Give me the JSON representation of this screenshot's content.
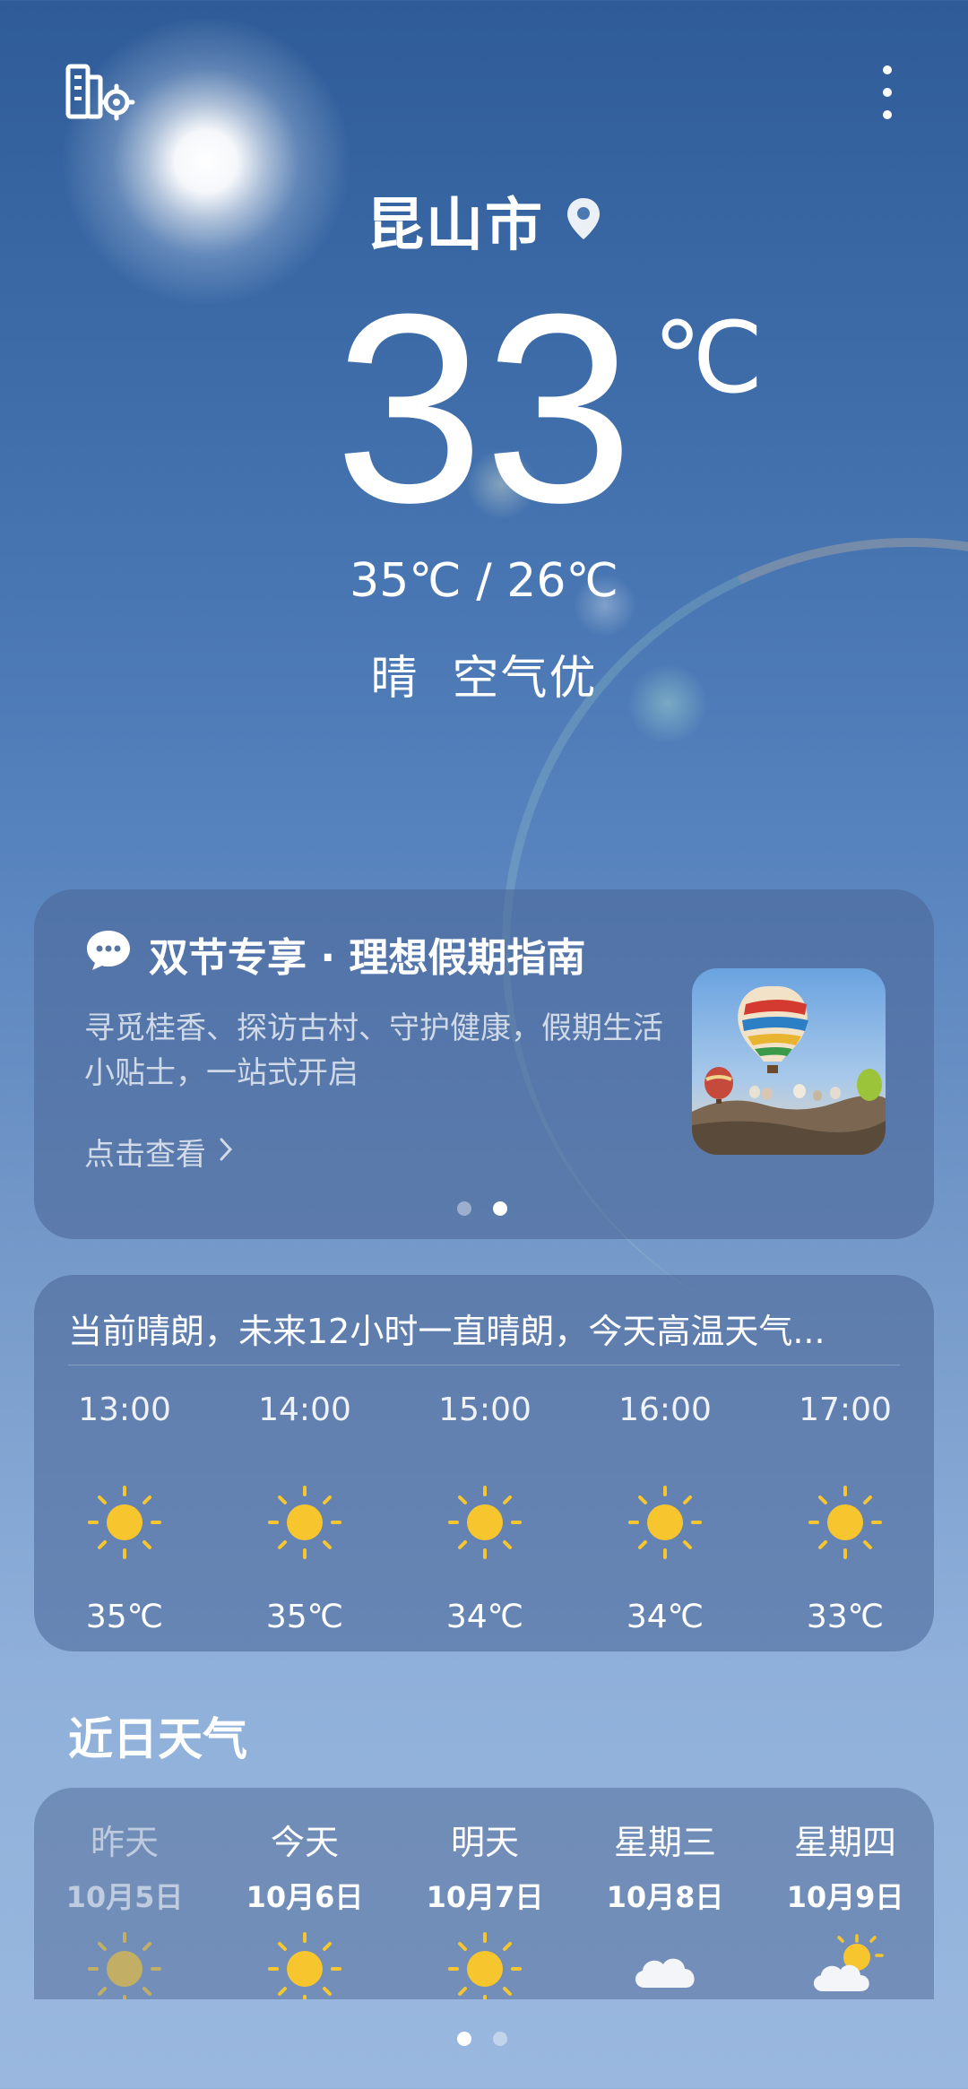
{
  "location": {
    "city": "昆山市"
  },
  "current": {
    "temperature": "33",
    "unit": "℃",
    "range": "35℃ / 26℃",
    "condition": "晴  空气优"
  },
  "promo": {
    "title": "双节专享 · 理想假期指南",
    "description": "寻觅桂香、探访古村、守护健康，假期生活小贴士，一站式开启",
    "link": "点击查看",
    "image": "hot-air-balloons",
    "page_count": 2,
    "active_page": 2
  },
  "hourly": {
    "summary": "当前晴朗，未来12小时一直晴朗，今天高温天气...",
    "items": [
      {
        "time": "13:00",
        "icon": "sunny-icon",
        "temp": "35℃"
      },
      {
        "time": "14:00",
        "icon": "sunny-icon",
        "temp": "35℃"
      },
      {
        "time": "15:00",
        "icon": "sunny-icon",
        "temp": "34℃"
      },
      {
        "time": "16:00",
        "icon": "sunny-icon",
        "temp": "34℃"
      },
      {
        "time": "17:00",
        "icon": "sunny-icon",
        "temp": "33℃"
      }
    ]
  },
  "daily": {
    "title": "近日天气",
    "items": [
      {
        "day": "昨天",
        "date": "10月5日",
        "icon": "sunny-icon"
      },
      {
        "day": "今天",
        "date": "10月6日",
        "icon": "sunny-icon"
      },
      {
        "day": "明天",
        "date": "10月7日",
        "icon": "sunny-icon"
      },
      {
        "day": "星期三",
        "date": "10月8日",
        "icon": "cloudy-icon"
      },
      {
        "day": "星期四",
        "date": "10月9日",
        "icon": "partly-cloudy-icon"
      }
    ]
  },
  "pager": {
    "page_count": 2,
    "active_page": 1
  },
  "colors": {
    "sun": "#f7c62f",
    "sun_ray": "#f7c62f"
  }
}
